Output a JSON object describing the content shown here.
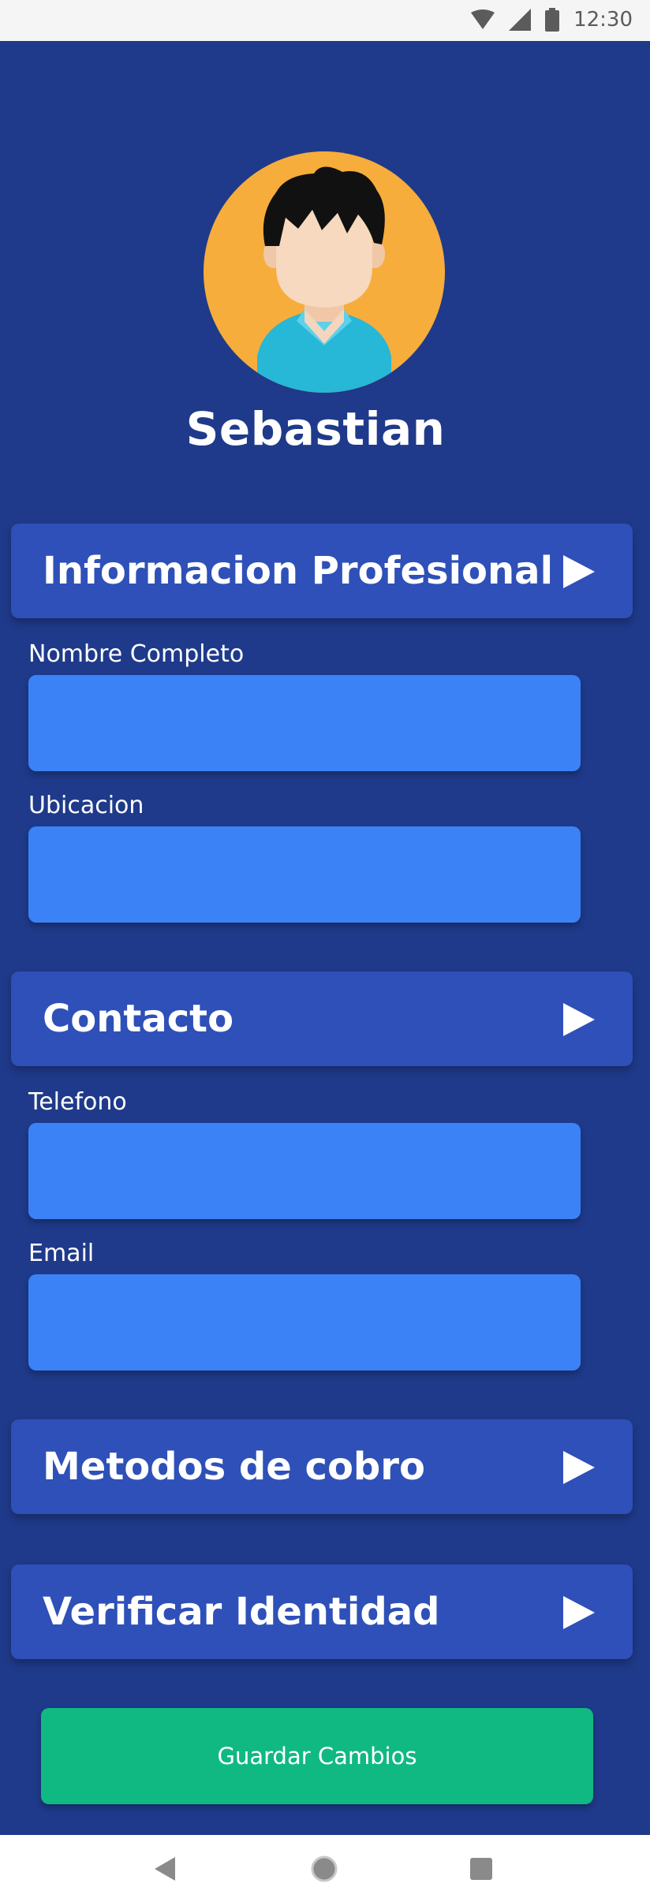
{
  "status_bar": {
    "time": "12:30",
    "icons": [
      "wifi-icon",
      "cell-signal-icon",
      "battery-icon"
    ]
  },
  "profile": {
    "name": "Sebastian",
    "avatar_icon": "avatar-boy-icon"
  },
  "sections": {
    "professional": {
      "title": "Informacion Profesional",
      "fields": [
        {
          "label": "Nombre Completo",
          "value": "",
          "placeholder": ""
        },
        {
          "label": "Ubicacion",
          "value": "",
          "placeholder": ""
        }
      ]
    },
    "contact": {
      "title": "Contacto",
      "fields": [
        {
          "label": "Telefono",
          "value": "",
          "placeholder": ""
        },
        {
          "label": "Email",
          "value": "",
          "placeholder": ""
        }
      ]
    },
    "payment": {
      "title": "Metodos de cobro"
    },
    "identity": {
      "title": "Verificar Identidad"
    }
  },
  "save_button": {
    "label": "Guardar Cambios"
  },
  "nav_bar": {
    "icons": [
      "back-icon",
      "home-icon",
      "recents-icon"
    ]
  },
  "colors": {
    "background": "#1f3a8a",
    "section_header": "#2e50b8",
    "input": "#3b82f6",
    "save_button": "#10b981",
    "avatar_background": "#f6ad3b"
  }
}
